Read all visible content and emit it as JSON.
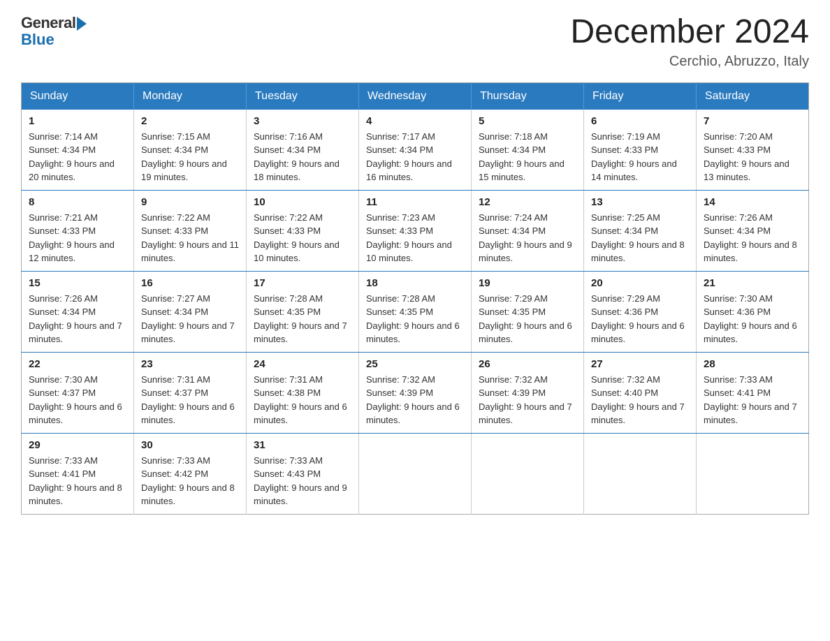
{
  "logo": {
    "general": "General",
    "blue": "Blue"
  },
  "header": {
    "title": "December 2024",
    "subtitle": "Cerchio, Abruzzo, Italy"
  },
  "days_of_week": [
    "Sunday",
    "Monday",
    "Tuesday",
    "Wednesday",
    "Thursday",
    "Friday",
    "Saturday"
  ],
  "weeks": [
    [
      {
        "day": "1",
        "sunrise": "7:14 AM",
        "sunset": "4:34 PM",
        "daylight": "9 hours and 20 minutes."
      },
      {
        "day": "2",
        "sunrise": "7:15 AM",
        "sunset": "4:34 PM",
        "daylight": "9 hours and 19 minutes."
      },
      {
        "day": "3",
        "sunrise": "7:16 AM",
        "sunset": "4:34 PM",
        "daylight": "9 hours and 18 minutes."
      },
      {
        "day": "4",
        "sunrise": "7:17 AM",
        "sunset": "4:34 PM",
        "daylight": "9 hours and 16 minutes."
      },
      {
        "day": "5",
        "sunrise": "7:18 AM",
        "sunset": "4:34 PM",
        "daylight": "9 hours and 15 minutes."
      },
      {
        "day": "6",
        "sunrise": "7:19 AM",
        "sunset": "4:33 PM",
        "daylight": "9 hours and 14 minutes."
      },
      {
        "day": "7",
        "sunrise": "7:20 AM",
        "sunset": "4:33 PM",
        "daylight": "9 hours and 13 minutes."
      }
    ],
    [
      {
        "day": "8",
        "sunrise": "7:21 AM",
        "sunset": "4:33 PM",
        "daylight": "9 hours and 12 minutes."
      },
      {
        "day": "9",
        "sunrise": "7:22 AM",
        "sunset": "4:33 PM",
        "daylight": "9 hours and 11 minutes."
      },
      {
        "day": "10",
        "sunrise": "7:22 AM",
        "sunset": "4:33 PM",
        "daylight": "9 hours and 10 minutes."
      },
      {
        "day": "11",
        "sunrise": "7:23 AM",
        "sunset": "4:33 PM",
        "daylight": "9 hours and 10 minutes."
      },
      {
        "day": "12",
        "sunrise": "7:24 AM",
        "sunset": "4:34 PM",
        "daylight": "9 hours and 9 minutes."
      },
      {
        "day": "13",
        "sunrise": "7:25 AM",
        "sunset": "4:34 PM",
        "daylight": "9 hours and 8 minutes."
      },
      {
        "day": "14",
        "sunrise": "7:26 AM",
        "sunset": "4:34 PM",
        "daylight": "9 hours and 8 minutes."
      }
    ],
    [
      {
        "day": "15",
        "sunrise": "7:26 AM",
        "sunset": "4:34 PM",
        "daylight": "9 hours and 7 minutes."
      },
      {
        "day": "16",
        "sunrise": "7:27 AM",
        "sunset": "4:34 PM",
        "daylight": "9 hours and 7 minutes."
      },
      {
        "day": "17",
        "sunrise": "7:28 AM",
        "sunset": "4:35 PM",
        "daylight": "9 hours and 7 minutes."
      },
      {
        "day": "18",
        "sunrise": "7:28 AM",
        "sunset": "4:35 PM",
        "daylight": "9 hours and 6 minutes."
      },
      {
        "day": "19",
        "sunrise": "7:29 AM",
        "sunset": "4:35 PM",
        "daylight": "9 hours and 6 minutes."
      },
      {
        "day": "20",
        "sunrise": "7:29 AM",
        "sunset": "4:36 PM",
        "daylight": "9 hours and 6 minutes."
      },
      {
        "day": "21",
        "sunrise": "7:30 AM",
        "sunset": "4:36 PM",
        "daylight": "9 hours and 6 minutes."
      }
    ],
    [
      {
        "day": "22",
        "sunrise": "7:30 AM",
        "sunset": "4:37 PM",
        "daylight": "9 hours and 6 minutes."
      },
      {
        "day": "23",
        "sunrise": "7:31 AM",
        "sunset": "4:37 PM",
        "daylight": "9 hours and 6 minutes."
      },
      {
        "day": "24",
        "sunrise": "7:31 AM",
        "sunset": "4:38 PM",
        "daylight": "9 hours and 6 minutes."
      },
      {
        "day": "25",
        "sunrise": "7:32 AM",
        "sunset": "4:39 PM",
        "daylight": "9 hours and 6 minutes."
      },
      {
        "day": "26",
        "sunrise": "7:32 AM",
        "sunset": "4:39 PM",
        "daylight": "9 hours and 7 minutes."
      },
      {
        "day": "27",
        "sunrise": "7:32 AM",
        "sunset": "4:40 PM",
        "daylight": "9 hours and 7 minutes."
      },
      {
        "day": "28",
        "sunrise": "7:33 AM",
        "sunset": "4:41 PM",
        "daylight": "9 hours and 7 minutes."
      }
    ],
    [
      {
        "day": "29",
        "sunrise": "7:33 AM",
        "sunset": "4:41 PM",
        "daylight": "9 hours and 8 minutes."
      },
      {
        "day": "30",
        "sunrise": "7:33 AM",
        "sunset": "4:42 PM",
        "daylight": "9 hours and 8 minutes."
      },
      {
        "day": "31",
        "sunrise": "7:33 AM",
        "sunset": "4:43 PM",
        "daylight": "9 hours and 9 minutes."
      },
      null,
      null,
      null,
      null
    ]
  ]
}
